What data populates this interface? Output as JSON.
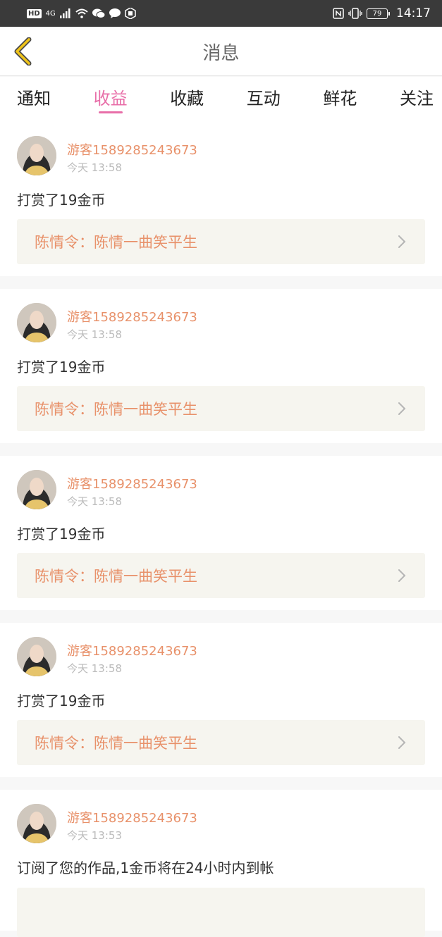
{
  "status_bar": {
    "left_badge": "HD",
    "network": "4G",
    "icons": [
      "signal-icon",
      "wifi-icon",
      "wechat-icon",
      "chat-bubble-icon",
      "app-icon"
    ],
    "right_icons": [
      "nfc-icon",
      "vibrate-icon"
    ],
    "battery": "79",
    "time": "14:17"
  },
  "navbar": {
    "title": "消息",
    "back_icon": "chevron-left-icon",
    "accent_color": "#f0c419"
  },
  "tabs": [
    {
      "label": "通知",
      "active": false
    },
    {
      "label": "收益",
      "active": true
    },
    {
      "label": "收藏",
      "active": false
    },
    {
      "label": "互动",
      "active": false
    },
    {
      "label": "鲜花",
      "active": false
    },
    {
      "label": "关注",
      "active": false
    }
  ],
  "colors": {
    "active_tab": "#e86ea8",
    "username": "#e8916a",
    "work_bg": "#f6f5ef"
  },
  "messages": [
    {
      "user": "游客1589285243673",
      "time": "今天 13:58",
      "text": "打赏了19金币",
      "work": "陈情令：陈情一曲笑平生"
    },
    {
      "user": "游客1589285243673",
      "time": "今天 13:58",
      "text": "打赏了19金币",
      "work": "陈情令：陈情一曲笑平生"
    },
    {
      "user": "游客1589285243673",
      "time": "今天 13:58",
      "text": "打赏了19金币",
      "work": "陈情令：陈情一曲笑平生"
    },
    {
      "user": "游客1589285243673",
      "time": "今天 13:58",
      "text": "打赏了19金币",
      "work": "陈情令：陈情一曲笑平生"
    },
    {
      "user": "游客1589285243673",
      "time": "今天 13:53",
      "text": "订阅了您的作品,1金币将在24小时内到帐",
      "work": ""
    }
  ]
}
